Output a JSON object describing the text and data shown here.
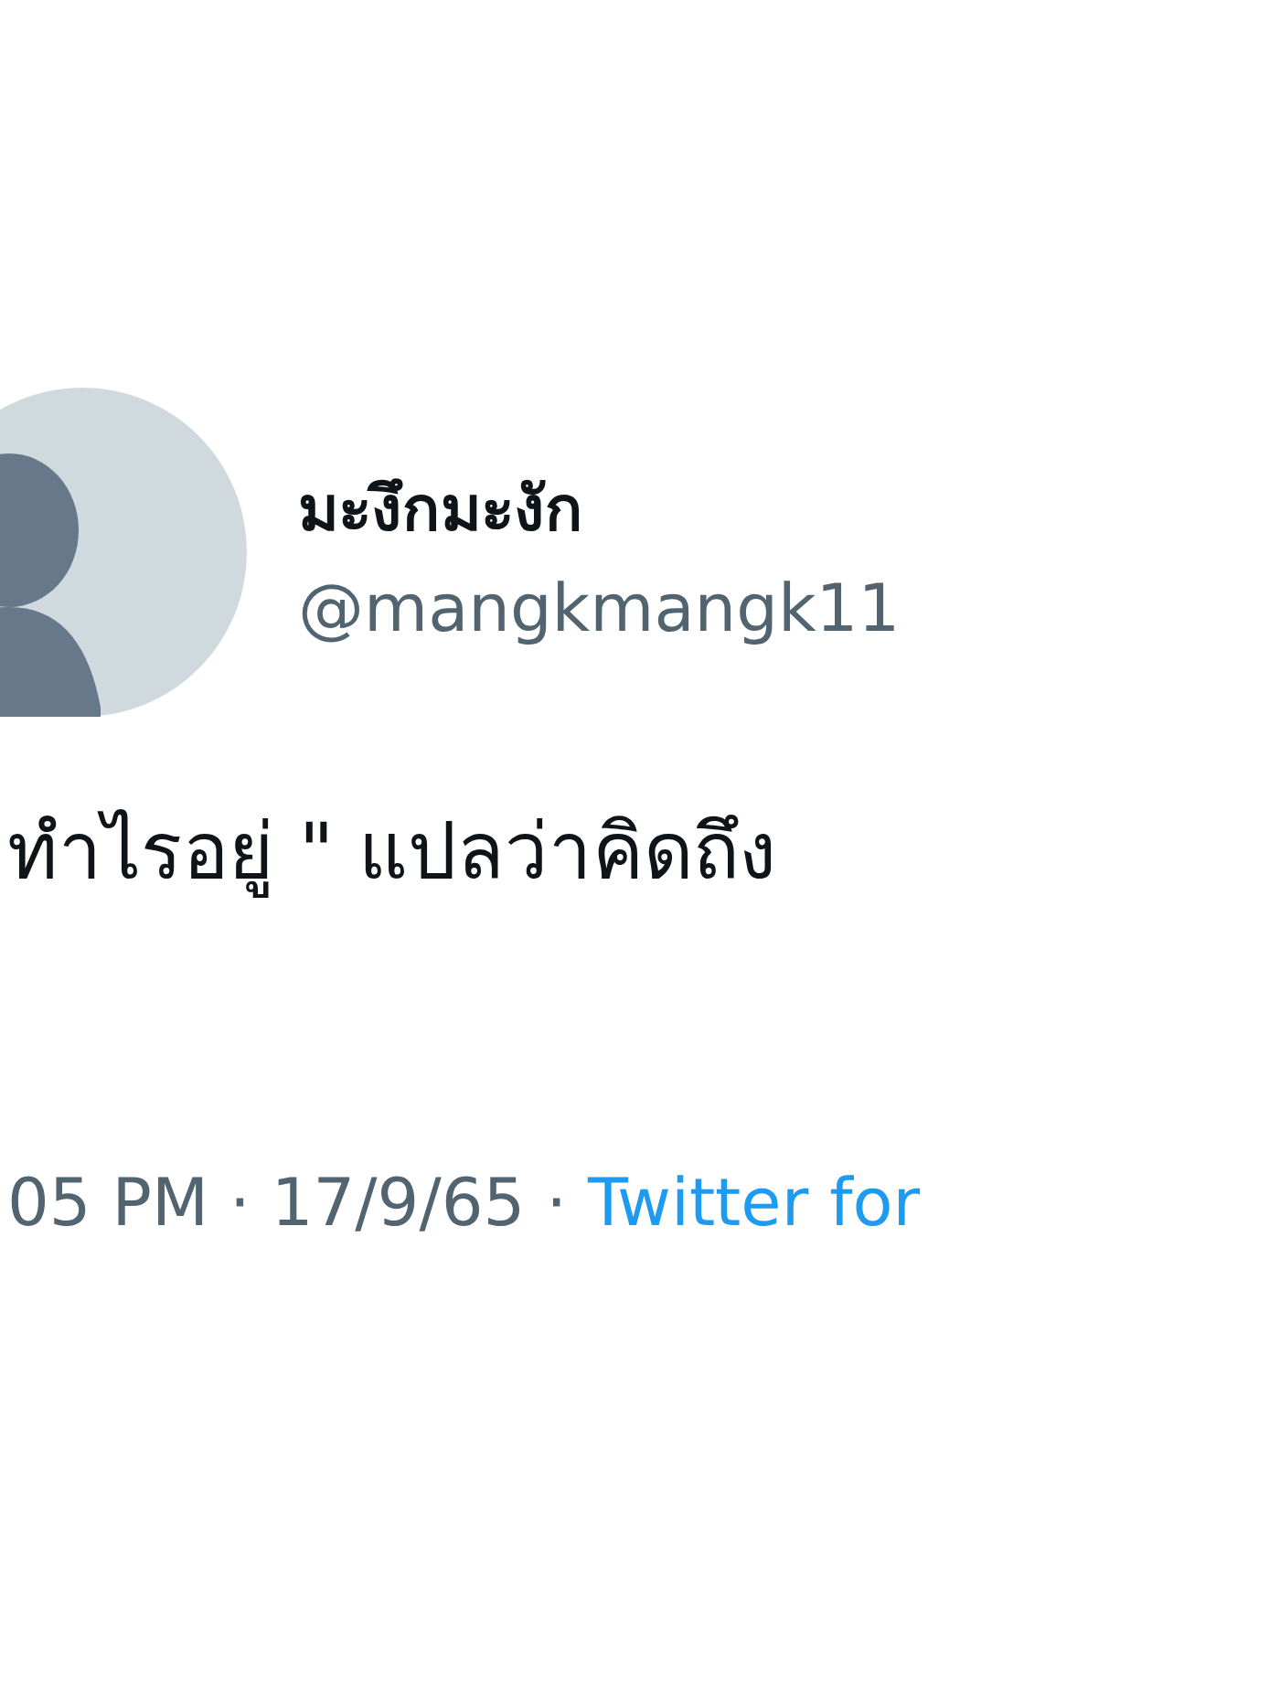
{
  "author": {
    "name": "มะงึกมะงัก",
    "handle": "@mangkmangk11"
  },
  "tweet": {
    "text": "ทำไรอยู่ \" แปลว่าคิดถึง"
  },
  "meta": {
    "time": "05 PM · 17/9/65 · ",
    "source": "Twitter for"
  }
}
